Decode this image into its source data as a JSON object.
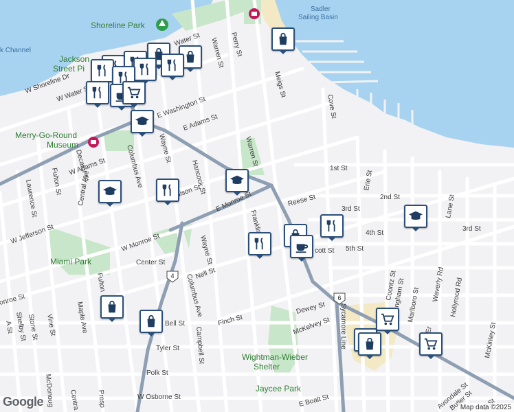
{
  "map": {
    "colors": {
      "water": "#a8d3f0",
      "land": "#f2f2f4",
      "park": "#c8e6c9",
      "street": "#ffffff",
      "major_road": "#8e9fb3",
      "pin_border": "#2a4f7a",
      "pin_icon": "#1f3d60"
    },
    "pois": {
      "shoreline_park": "Shoreline Park",
      "jackson_street_pier_1": "Jackson",
      "jackson_street_pier_2": "Street Pi",
      "merry_go_round_1": "Merry-Go-Round",
      "merry_go_round_2": "Museum",
      "miami_park": "Miami Park",
      "wightman_1": "Wightman-Wieber",
      "wightman_2": "Shelter",
      "jaycee_park": "Jaycee Park"
    },
    "water": {
      "sadler_1": "Sadler",
      "sadler_2": "Sailing Basin",
      "channel": "k Channel"
    },
    "streets": {
      "w_shoreline": "W Shoreline Dr",
      "w_water": "W Water St",
      "water": "Water St",
      "perry": "Perry St",
      "warren_n": "Warren St",
      "warren_s": "Warren St",
      "meigs": "Meigs St",
      "e_washington": "E Washington St",
      "e_adams": "E Adams St",
      "cove": "Cove St",
      "first": "1st St",
      "second": "2nd St",
      "third_a": "3rd St",
      "third_b": "3rd St",
      "fourth": "4th St",
      "fifth": "5th St",
      "erie": "Erie St",
      "lane": "Lane St",
      "reese": "Reese St",
      "e_monroe": "E Monroe St",
      "franklin": "Franklin St",
      "columbus_n": "Columbus Ave",
      "columbus_s": "Columbus Ave",
      "wayne_n": "Wayne St",
      "wayne_s": "Wayne St",
      "hancock": "Hancock St",
      "madison": "dison St",
      "w_adams": "W Adams St",
      "decatur": "Decatur St",
      "fulton_n": "Fulton St",
      "fulton_s": "Fulton",
      "lawrence": "Lawrence St",
      "w_jefferson": "W Jefferson St",
      "central_n": "Central Ave",
      "central_s": "Centra",
      "w_monroe": "W Monroe St",
      "center": "Center St",
      "nell": "Nell St",
      "monroe_sw": "onroe St",
      "shelby": "Shelby St",
      "a_st": "A St",
      "stone": "Stone St",
      "vine": "Vine St",
      "maple": "Maple Ave",
      "bell": "Bell St",
      "tyler": "Tyler St",
      "campbell": "Campbell St",
      "polk": "Polk St",
      "w_osborne": "W Osborne St",
      "mcdonough": "McDonoug",
      "prosp": "Prosp",
      "finch": "Finch St",
      "dewey": "Dewey St",
      "mckelvey": "McKelvey St",
      "sycamore": "Sycamore Line",
      "e_boalt": "E Boalt St",
      "scott": "cott St",
      "coontz": "Coontz St",
      "ingham": "ngham St",
      "marlboro": "Marlboro St",
      "waverly": "Waverly Rd",
      "hollyrood": "Hollyrood Rd",
      "mckinley": "McKinley St",
      "avondale": "Avondale St",
      "butler": "Butler St",
      "lt_st": "Lt St",
      "erie_s": "Er"
    },
    "shields": {
      "route_4": "4",
      "route_6": "6"
    },
    "google_logo": "Google",
    "attribution": "Map data ©2025"
  }
}
